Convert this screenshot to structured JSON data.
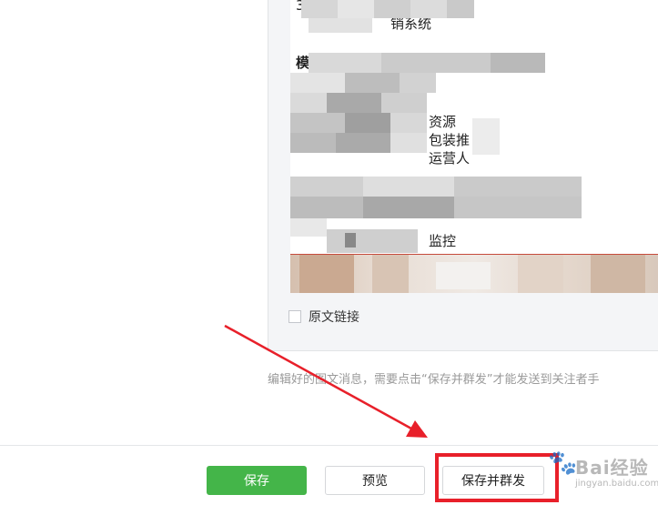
{
  "editor": {
    "article": {
      "lines": [
        {
          "text": "3"
        },
        {
          "text": "销系统"
        },
        {
          "text": "模"
        },
        {
          "text": "资源"
        },
        {
          "text": "包装推"
        },
        {
          "text": "运营人"
        },
        {
          "text": "监控"
        }
      ]
    },
    "original_link": {
      "label": "原文链接",
      "checked": false
    }
  },
  "hint": {
    "text": "编辑好的图文消息，需要点击“保存并群发”才能发送到关注者手"
  },
  "footer": {
    "save_label": "保存",
    "preview_label": "预览",
    "save_and_send_label": "保存并群发"
  },
  "watermark": {
    "text": "Bai经验",
    "sub": "jingyan.baidu.com"
  },
  "colors": {
    "primary_green": "#44b549",
    "highlight_red": "#e8202a",
    "editor_bg": "#f4f5f7",
    "hint_gray": "#9a9a9a"
  }
}
